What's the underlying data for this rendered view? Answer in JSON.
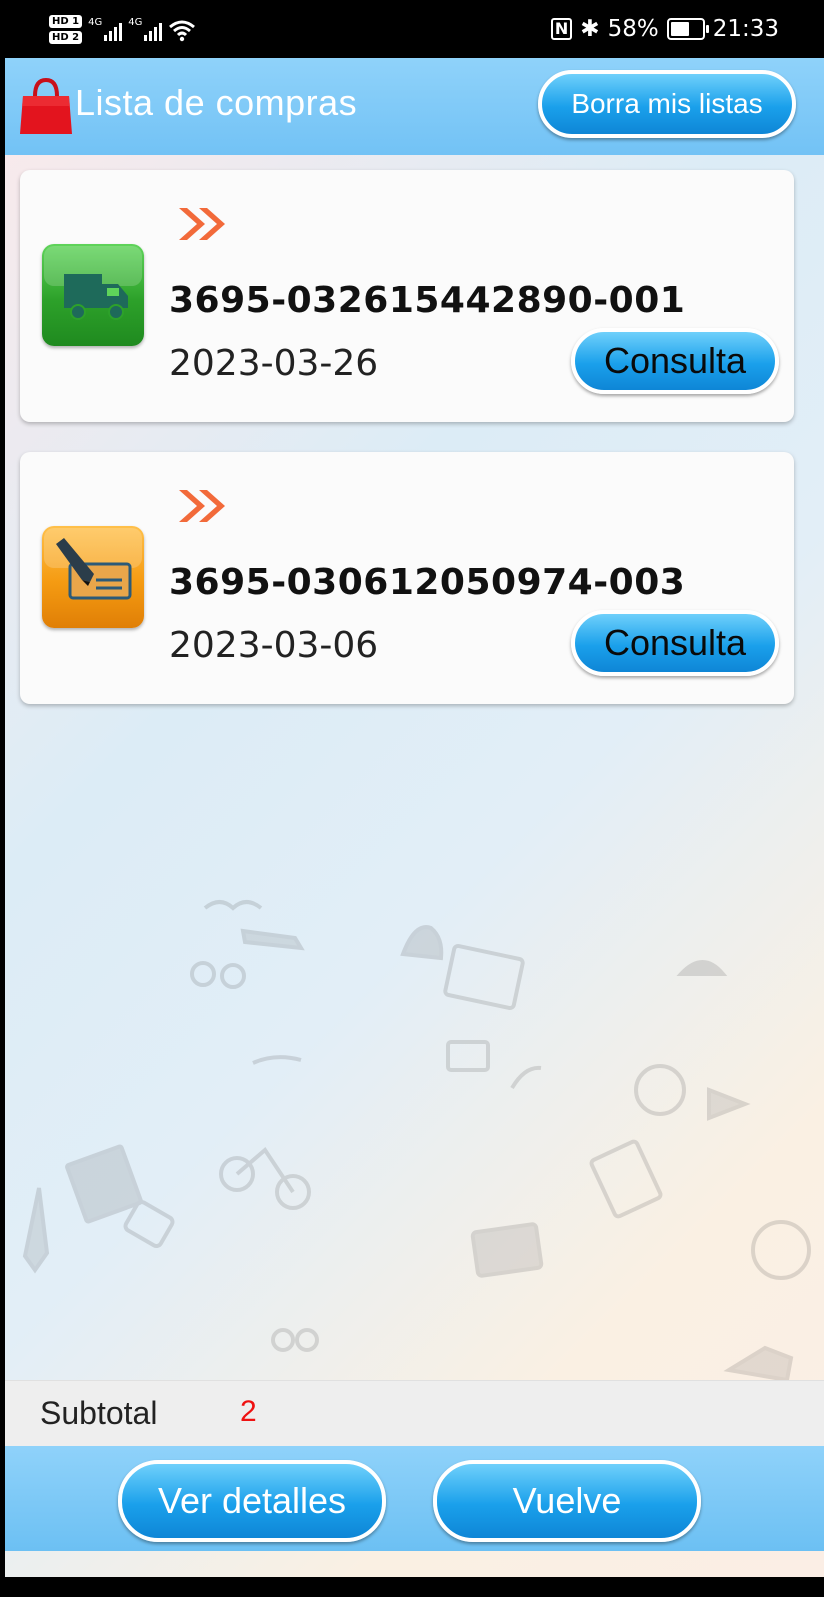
{
  "status_bar": {
    "hd1": "HD 1",
    "hd2": "HD 2",
    "signal1": "4G",
    "signal2": "4G",
    "nfc": "N",
    "bluetooth": "✱",
    "battery": "58%",
    "time": "21:33"
  },
  "header": {
    "title": "Lista de compras",
    "clear_button": "Borra mis listas",
    "icon": "shopping-bag-icon",
    "color": "#78c6f6"
  },
  "orders": [
    {
      "icon": "delivery-truck-icon",
      "icon_color": "#2da12a",
      "number": "3695-032615442890-001",
      "date": "2023-03-26",
      "button": "Consulta"
    },
    {
      "icon": "signed-document-icon",
      "icon_color": "#f59b12",
      "number": "3695-030612050974-003",
      "date": "2023-03-06",
      "button": "Consulta"
    }
  ],
  "subtotal": {
    "label": "Subtotal",
    "value": "2"
  },
  "footer": {
    "details_button": "Ver detalles",
    "back_button": "Vuelve"
  }
}
